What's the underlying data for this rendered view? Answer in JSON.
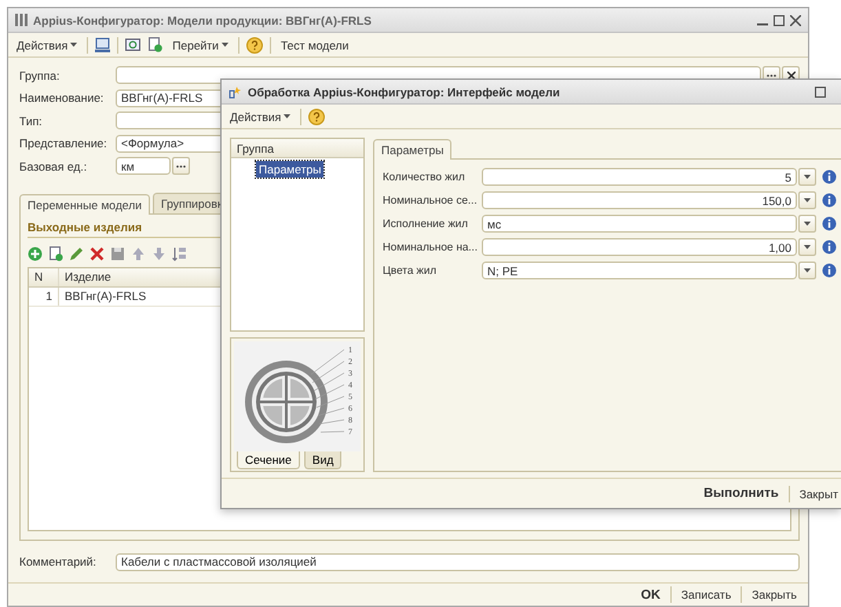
{
  "main_window": {
    "title": "Appius-Конфигуратор: Модели продукции: ВВГнг(А)-FRLS",
    "toolbar": {
      "actions": "Действия",
      "goto": "Перейти",
      "test": "Тест модели"
    },
    "fields": [
      {
        "kind": "clearable",
        "label": "Группа:"
      },
      {
        "kind": "text",
        "label": "Наименование:",
        "value": "ВВГнг(А)-FRLS"
      },
      {
        "kind": "text",
        "label": "Тип:"
      },
      {
        "kind": "text",
        "label": "Представление:",
        "value": "<Формула>"
      },
      {
        "kind": "picker",
        "label": "Базовая ед.:",
        "value": "км"
      }
    ],
    "tabs": [
      {
        "label": "Переменные модели",
        "selected": true
      },
      {
        "label": "Группировк",
        "selected": false
      }
    ],
    "section_title": "Выходные изделия",
    "table": {
      "columns": [
        "N",
        "Изделие"
      ],
      "rows": [
        [
          "1",
          "ВВГнг(А)-FRLS"
        ]
      ]
    },
    "comment": {
      "label": "Комментарий:",
      "value": "Кабели с пластмассовой изоляцией"
    },
    "buttons": [
      {
        "label": "OK",
        "primary": true
      },
      {
        "label": "Записать",
        "primary": false
      },
      {
        "label": "Закрыть",
        "primary": false
      }
    ]
  },
  "dialog": {
    "title": "Обработка  Appius-Конфигуратор: Интерфейс модели",
    "toolbar": {
      "actions": "Действия"
    },
    "tree": {
      "header": "Группа",
      "items": [
        {
          "label": "Параметры",
          "selected": true
        }
      ]
    },
    "image_tabs": [
      {
        "label": "Сечение",
        "selected": true
      },
      {
        "label": "Вид",
        "selected": false
      }
    ],
    "image_callouts": [
      "1",
      "2",
      "3",
      "4",
      "5",
      "6",
      "8",
      "7"
    ],
    "param_tabs": [
      {
        "label": "Параметры",
        "selected": true
      }
    ],
    "params": [
      {
        "label": "Количество жил",
        "value": "5",
        "kind": "number"
      },
      {
        "label": "Номинальное се...",
        "value": "150,0",
        "kind": "number"
      },
      {
        "label": "Исполнение жил",
        "value": "мс",
        "kind": "text"
      },
      {
        "label": "Номинальное на...",
        "value": "1,00",
        "kind": "number"
      },
      {
        "label": "Цвета жил",
        "value": "N; PE",
        "kind": "text"
      }
    ],
    "buttons": [
      {
        "label": "Выполнить",
        "primary": true
      },
      {
        "label": "Закрыт",
        "primary": false
      }
    ]
  }
}
